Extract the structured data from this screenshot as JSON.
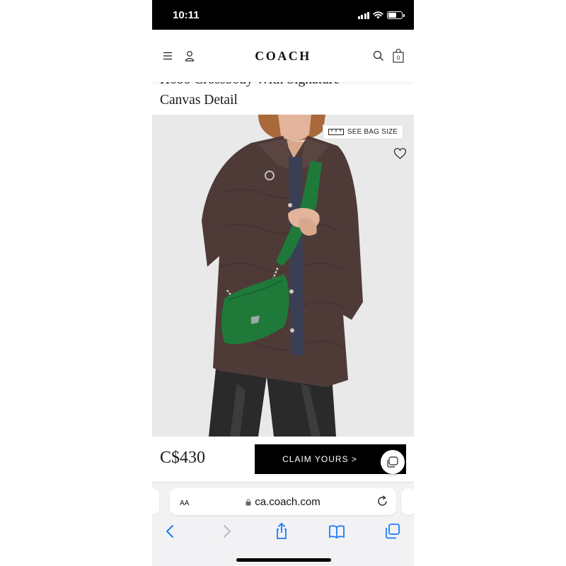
{
  "status_bar": {
    "time": "10:11"
  },
  "header": {
    "logo": "COACH",
    "bag_count": "0",
    "icons": [
      "menu-icon",
      "account-icon",
      "search-icon",
      "shopping-bag-icon"
    ]
  },
  "product": {
    "title_line1": "Hobo Crossbody With Signature",
    "title_line2": "Canvas Detail",
    "see_bag_size": "SEE BAG SIZE",
    "price": "C$430",
    "cta": "CLAIM YOURS >"
  },
  "browser": {
    "text_size_label": "AA",
    "url": "ca.coach.com",
    "icons": [
      "lock-icon",
      "reload-icon",
      "back-icon",
      "forward-icon",
      "share-icon",
      "bookmarks-icon",
      "tabs-icon"
    ]
  },
  "colors": {
    "accent": "#000000",
    "bag_green": "#1f7a3a",
    "jacket_brown": "#4e3b38",
    "image_background": "#e9e9e9",
    "ios_blue": "#1a7af8"
  }
}
